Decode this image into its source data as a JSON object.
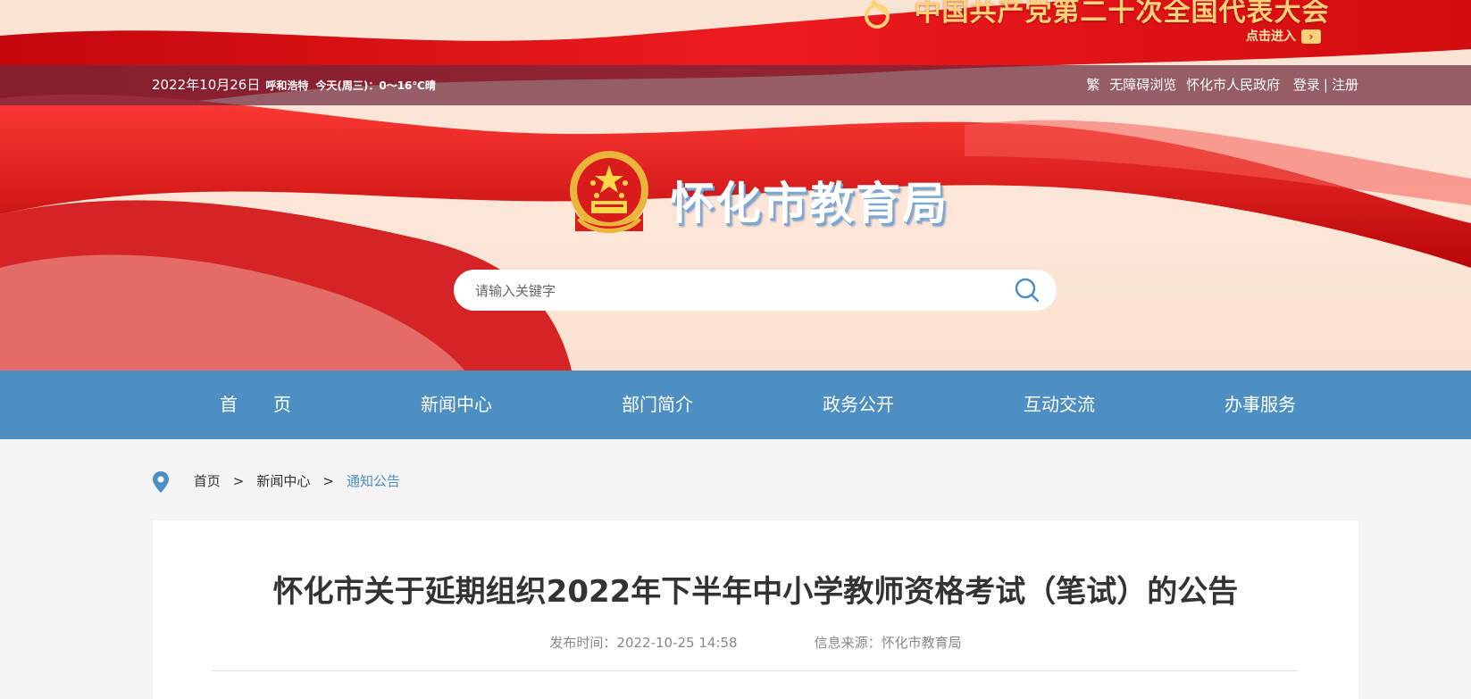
{
  "banner": {
    "party_title": "中国共产党第二十次全国代表大会",
    "enter_label": "点击进入"
  },
  "topbar": {
    "date": "2022年10月26日",
    "city": "呼和浩特",
    "weather": "今天(周三)：0～16℃晴",
    "traditional": "繁",
    "accessible": "无障碍浏览",
    "gov": "怀化市人民政府",
    "login": "登录",
    "separator": "|",
    "register": "注册"
  },
  "site": {
    "title": "怀化市教育局"
  },
  "search": {
    "placeholder": "请输入关键字"
  },
  "nav": {
    "items": [
      {
        "label": "首　　页"
      },
      {
        "label": "新闻中心"
      },
      {
        "label": "部门简介"
      },
      {
        "label": "政务公开"
      },
      {
        "label": "互动交流"
      },
      {
        "label": "办事服务"
      }
    ]
  },
  "breadcrumb": {
    "home": "首页",
    "gt": ">",
    "news": "新闻中心",
    "current": "通知公告"
  },
  "article": {
    "title": "怀化市关于延期组织2022年下半年中小学教师资格考试（笔试）的公告",
    "publish_time": "发布时间：2022-10-25 14:58",
    "source": "信息来源：怀化市教育局"
  },
  "colors": {
    "nav_bg": "#4d8fc2",
    "accent_red": "#d9141b",
    "link_blue": "#4d8fc2"
  }
}
